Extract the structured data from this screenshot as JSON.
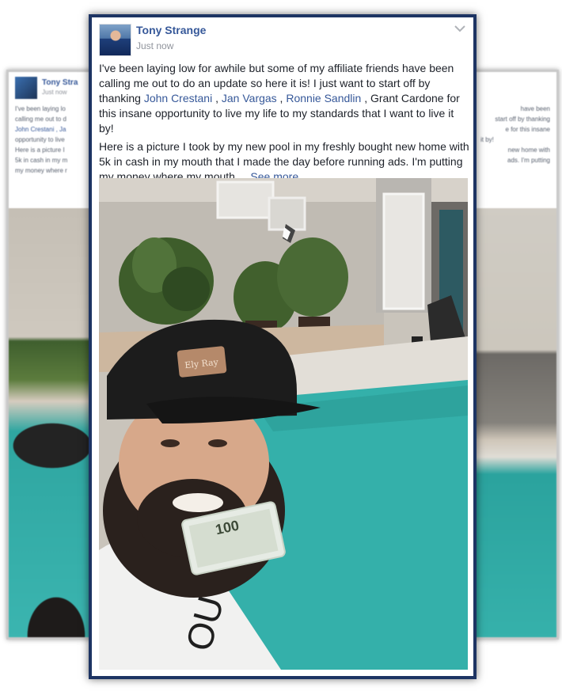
{
  "post": {
    "author": "Tony Strange",
    "timestamp": "Just now",
    "paragraph1": {
      "intro": "I've been laying low for awhile but some of my affiliate friends have been calling me out to do an update so here it is! I just want to start off by thanking ",
      "mentions": [
        "John Crestani",
        "Jan Vargas",
        "Ronnie Sandlin"
      ],
      "sep1": " , ",
      "sep2": " , ",
      "after_mentions": " , Grant Cardone for this insane opportunity to live my life to my standards that I want to live it by!"
    },
    "paragraph2": "Here is a picture I took by my new pool in my freshly bought new home with 5k in cash in my mouth that I made the day before running ads. I'm putting my money where my mouth",
    "ellipsis": " ... ",
    "see_more": "See more",
    "banknote_text": "100",
    "cap_patch_text": "Ely Ray"
  },
  "ghost_left": {
    "name": "Tony Stra",
    "time": "Just now",
    "lines": [
      "I've been laying lo",
      "calling me out to d",
      "John Crestani , Ja",
      "opportunity to live",
      "Here is a picture I",
      "5k in cash in my m",
      "my money where r"
    ]
  },
  "ghost_right": {
    "lines": [
      "have been",
      "start off by thanking",
      "e for this insane",
      "it by!",
      "new home with",
      "ads. I'm putting"
    ]
  },
  "icons": {
    "chevron": "chevron-down-icon"
  },
  "colors": {
    "link": "#365899",
    "card_border": "#1d3463",
    "pool": "#34b0aa"
  }
}
